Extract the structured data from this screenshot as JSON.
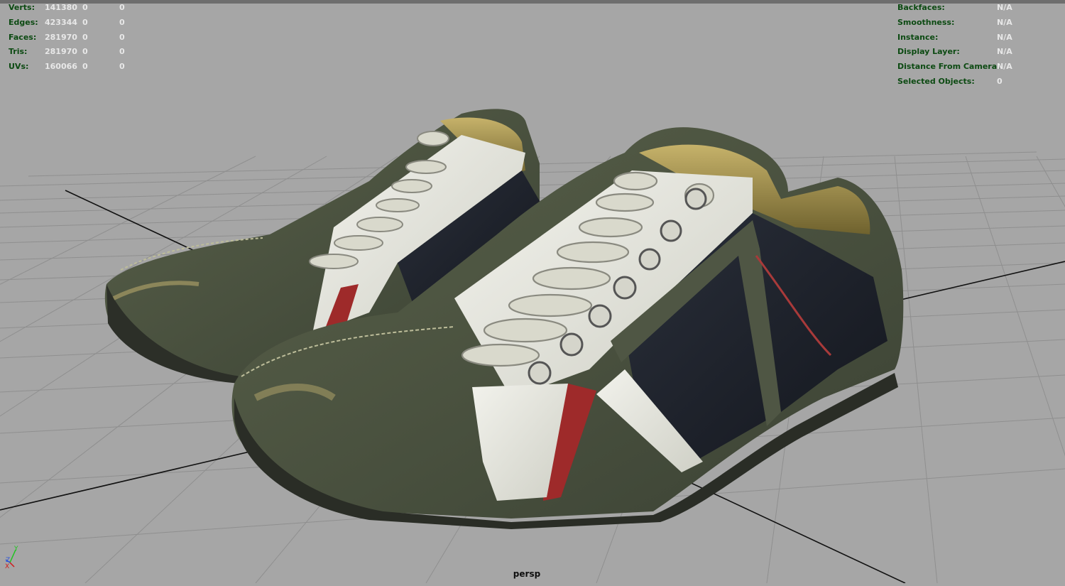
{
  "stats": {
    "rows": [
      {
        "label": "Verts:",
        "values": [
          "141380",
          "0",
          "0"
        ]
      },
      {
        "label": "Edges:",
        "values": [
          "423344",
          "0",
          "0"
        ]
      },
      {
        "label": "Faces:",
        "values": [
          "281970",
          "0",
          "0"
        ]
      },
      {
        "label": "Tris:",
        "values": [
          "281970",
          "0",
          "0"
        ]
      },
      {
        "label": "UVs:",
        "values": [
          "160066",
          "0",
          "0"
        ]
      }
    ]
  },
  "info": {
    "rows": [
      {
        "label": "Backfaces:",
        "value": "N/A"
      },
      {
        "label": "Smoothness:",
        "value": "N/A"
      },
      {
        "label": "Instance:",
        "value": "N/A"
      },
      {
        "label": "Display Layer:",
        "value": "N/A"
      },
      {
        "label": "Distance From Camera:",
        "value": "N/A"
      },
      {
        "label": "Selected Objects:",
        "value": "0"
      }
    ]
  },
  "viewport": {
    "camera": "persp",
    "background": "#a6a6a6",
    "grid_color": "#8f8f8f",
    "axis_line_color": "#000000",
    "model_name": "sneakers-model"
  },
  "gizmo": {
    "x_label": "X",
    "y_label": "Y",
    "z_label": "Z",
    "x_color": "#d01b1b",
    "y_color": "#1ec51e",
    "z_color": "#2d55d8"
  }
}
